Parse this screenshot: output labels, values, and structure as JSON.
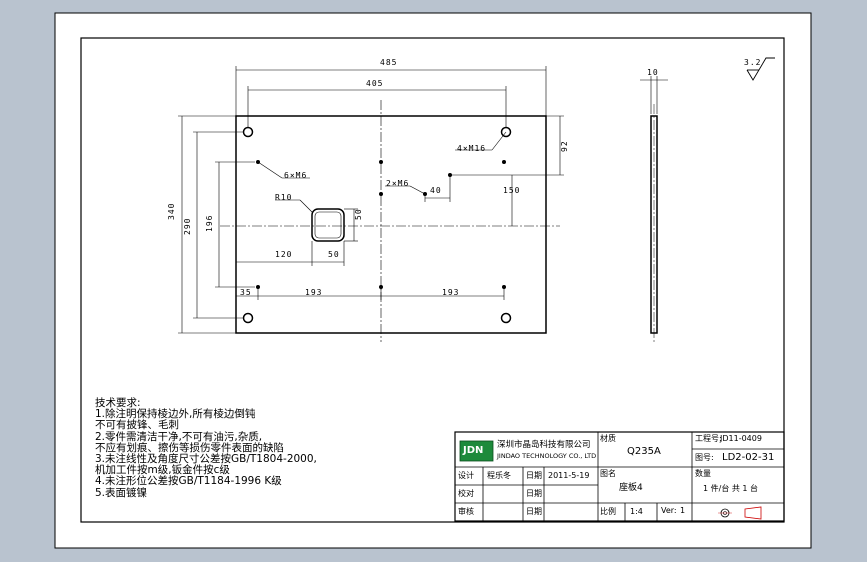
{
  "drawing": {
    "front_view": {
      "dims": {
        "overall_width": "485",
        "hole_span_width": "405",
        "overall_height": "340",
        "hole_span_height": "290",
        "inner_height": "196",
        "right_offset_top": "92",
        "right_spacing": "150",
        "small_spacing": "40",
        "left_spacing_1": "193",
        "left_spacing_2": "193",
        "left_edge": "35",
        "window_offset": "120",
        "window_width": "50",
        "window_height": "50",
        "radius": "R10"
      },
      "callouts": {
        "holes_m16": "4×M16",
        "holes_m6_a": "6×M6",
        "holes_m6_b": "2×M6"
      }
    },
    "side_view": {
      "thickness": "10"
    },
    "roughness": "3.2"
  },
  "notes": {
    "heading": "技术要求:",
    "lines": [
      "1.除注明保持棱边外,所有棱边倒钝",
      "  不可有披锋、毛刺",
      "2.零件需清洁干净,不可有油污,杂质,",
      "  不应有划痕、擦伤等损伤零件表面的缺陷",
      "3.未注线性及角度尺寸公差按GB/T1804-2000,",
      "  机加工件按m级,钣金件按c级",
      "4.未注形位公差按GB/T1184-1996 K级",
      "5.表面镀镍"
    ]
  },
  "title_block": {
    "logo": "JDN",
    "company_cn": "深圳市晶岛科技有限公司",
    "company_en": "JINDAO TECHNOLOGY CO., LTD",
    "material_label": "材质",
    "material_value": "Q235A",
    "project_label": "工程号:",
    "project_value": "JD11-0409",
    "drawing_no_label": "图号:",
    "drawing_no_value": "LD2-02-31",
    "design_label": "设计",
    "designer": "程乐冬",
    "date_label_1": "日期",
    "date_value": "2011-5-19",
    "drawing_name_label": "图名",
    "drawing_name": "座板4",
    "quantity_label": "数量",
    "quantity_value": "1 件/台    共 1 台",
    "check_label": "校对",
    "date_label_2": "日期",
    "approve_label": "审核",
    "date_label_3": "日期",
    "scale_label": "比例",
    "scale_value": "1:4",
    "version_label": "Ver:",
    "version_value": "1"
  }
}
